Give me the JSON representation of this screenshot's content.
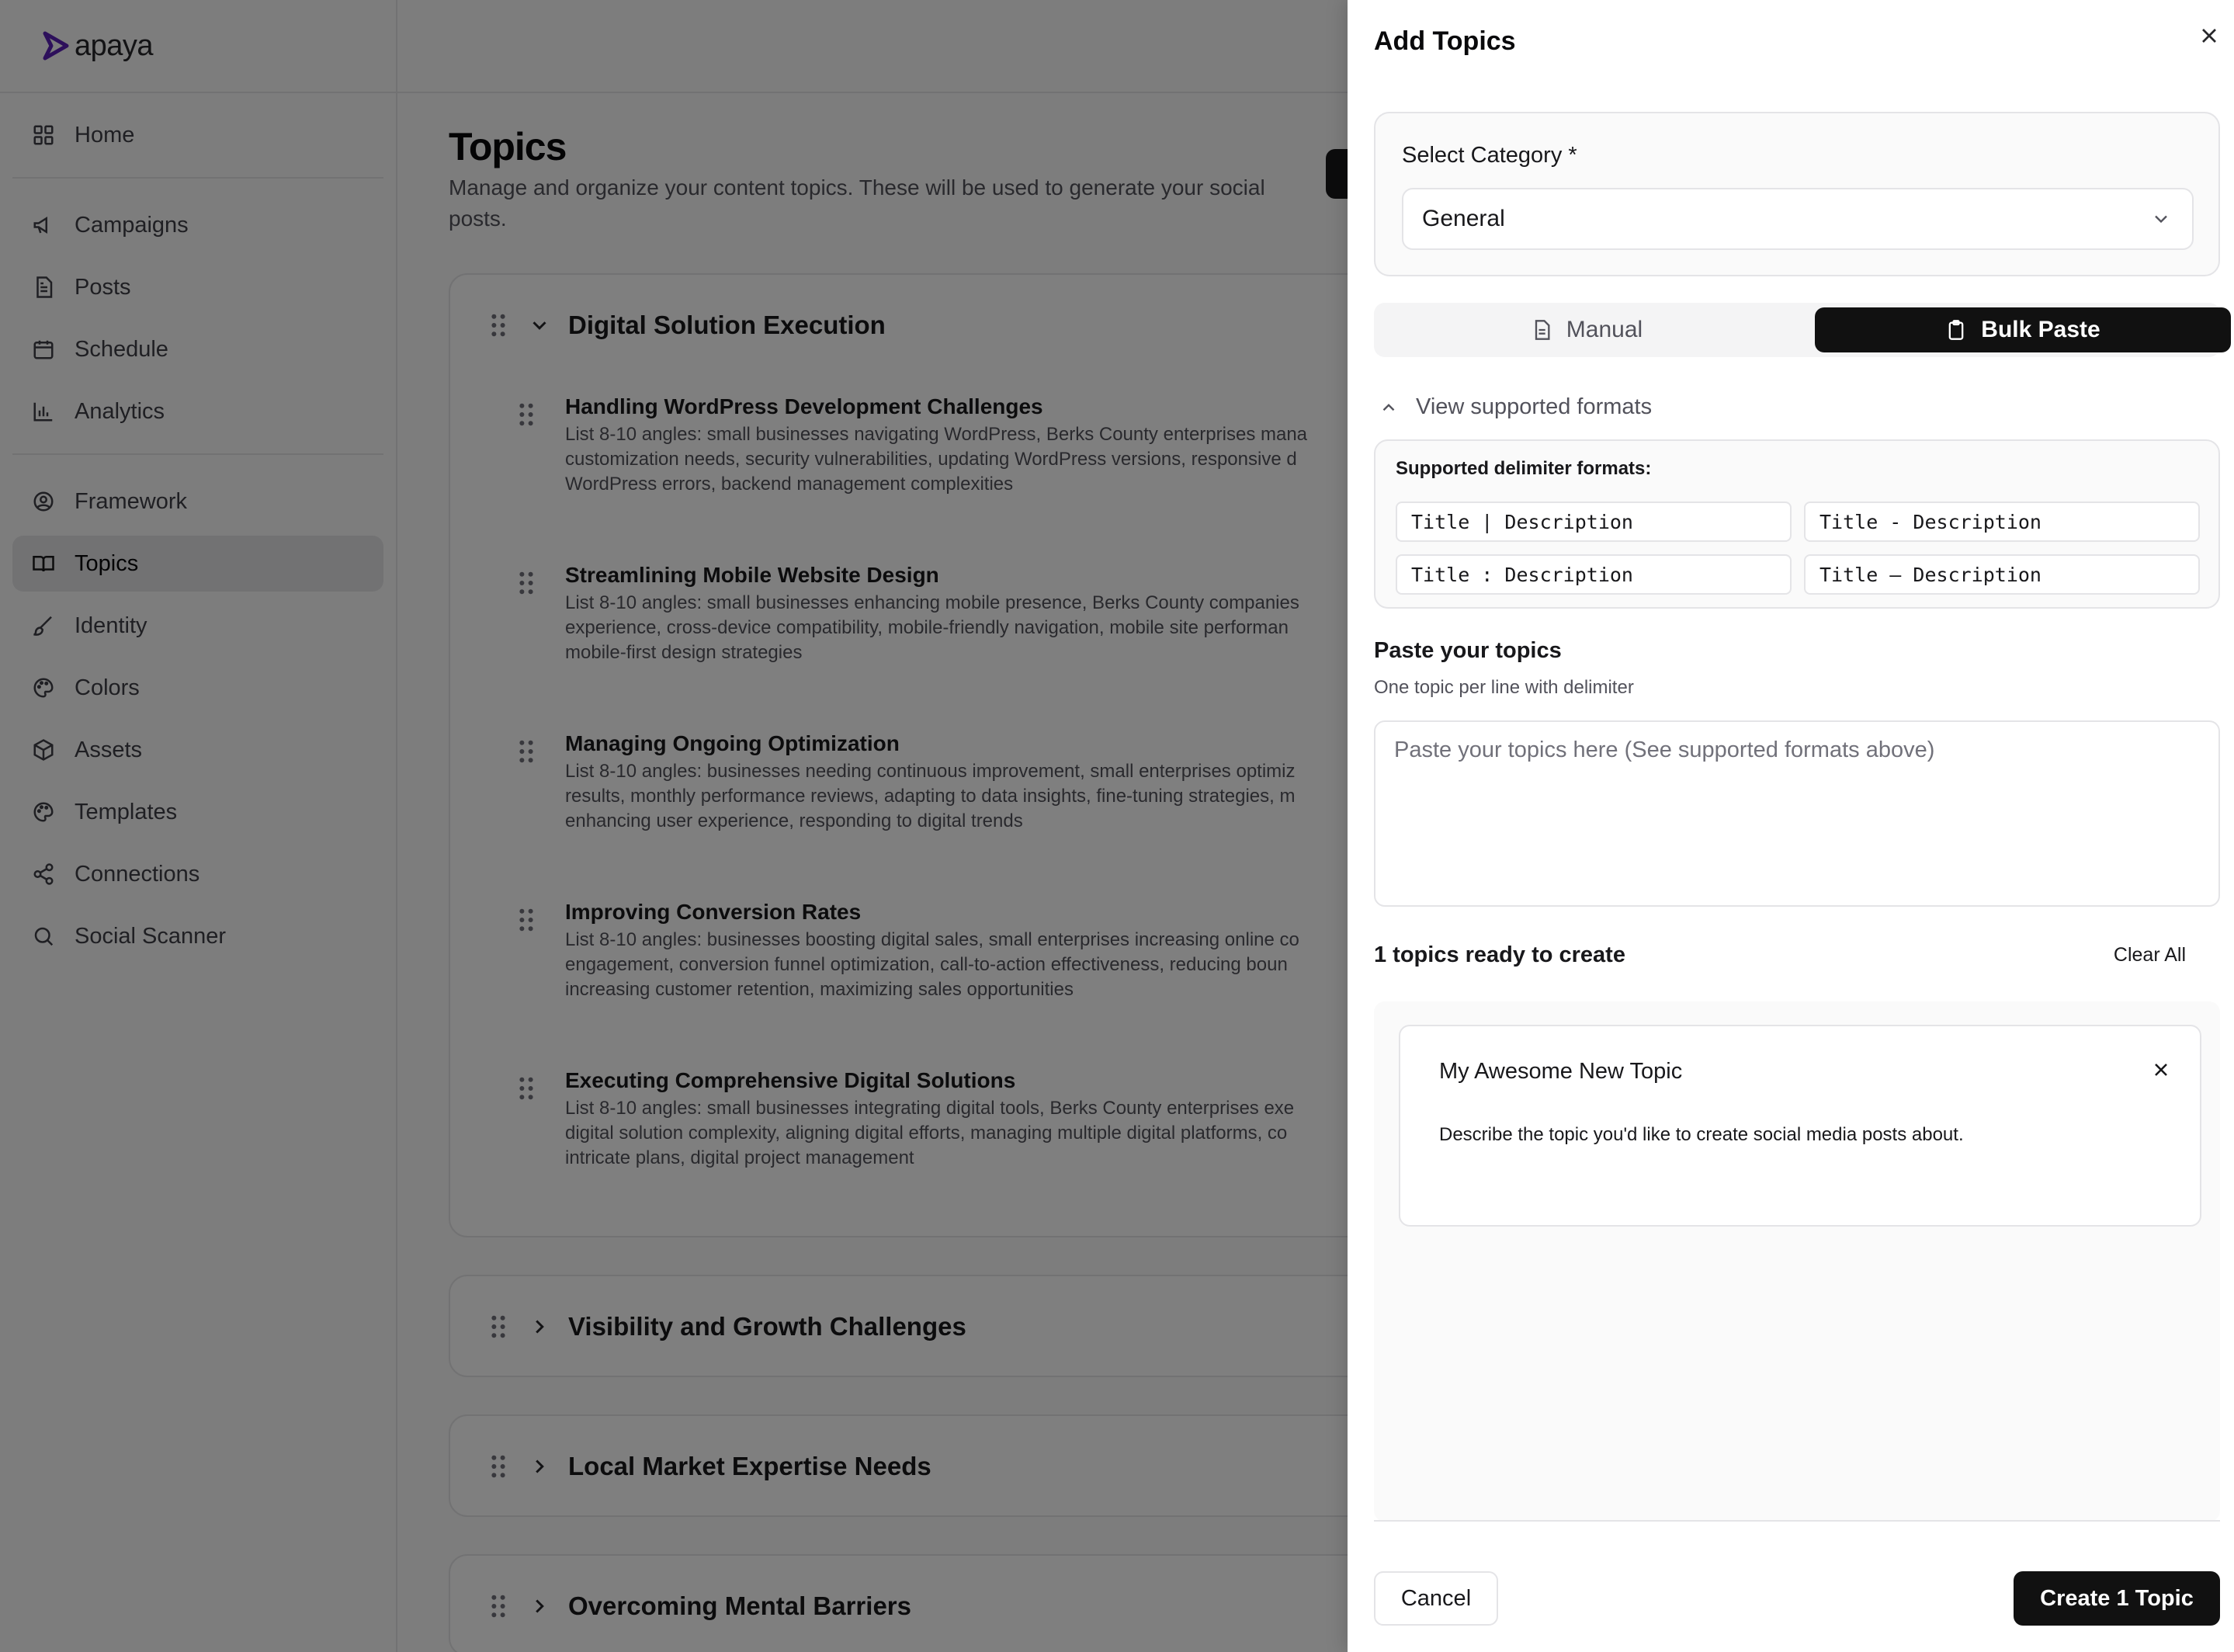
{
  "brand": {
    "name": "apaya",
    "accent": "#5b21b6"
  },
  "sidebar": {
    "items": [
      {
        "label": "Home",
        "icon": "home-grid-icon"
      },
      {
        "label": "Campaigns",
        "icon": "megaphone-icon"
      },
      {
        "label": "Posts",
        "icon": "document-icon"
      },
      {
        "label": "Schedule",
        "icon": "calendar-icon"
      },
      {
        "label": "Analytics",
        "icon": "bar-chart-icon"
      },
      {
        "label": "Framework",
        "icon": "user-circle-icon"
      },
      {
        "label": "Topics",
        "icon": "book-open-icon",
        "active": true
      },
      {
        "label": "Identity",
        "icon": "brush-icon"
      },
      {
        "label": "Colors",
        "icon": "palette-icon"
      },
      {
        "label": "Assets",
        "icon": "cube-icon"
      },
      {
        "label": "Templates",
        "icon": "palette-icon"
      },
      {
        "label": "Connections",
        "icon": "share-icon"
      },
      {
        "label": "Social Scanner",
        "icon": "search-icon"
      }
    ]
  },
  "page": {
    "title": "Topics",
    "subtitle": "Manage and organize your content topics. These will be used to generate your social posts."
  },
  "groups": [
    {
      "title": "Digital Solution Execution",
      "expanded": true,
      "topics": [
        {
          "title": "Handling WordPress Development Challenges",
          "desc_lines": [
            "List 8-10 angles: small businesses navigating WordPress, Berks County enterprises mana",
            "customization needs, security vulnerabilities, updating WordPress versions, responsive d",
            "WordPress errors, backend management complexities"
          ]
        },
        {
          "title": "Streamlining Mobile Website Design",
          "desc_lines": [
            "List 8-10 angles: small businesses enhancing mobile presence, Berks County companies",
            "experience, cross-device compatibility, mobile-friendly navigation, mobile site performan",
            "mobile-first design strategies"
          ]
        },
        {
          "title": "Managing Ongoing Optimization",
          "desc_lines": [
            "List 8-10 angles: businesses needing continuous improvement, small enterprises optimiz",
            "results, monthly performance reviews, adapting to data insights, fine-tuning strategies, m",
            "enhancing user experience, responding to digital trends"
          ]
        },
        {
          "title": "Improving Conversion Rates",
          "desc_lines": [
            "List 8-10 angles: businesses boosting digital sales, small enterprises increasing online co",
            "engagement, conversion funnel optimization, call-to-action effectiveness, reducing boun",
            "increasing customer retention, maximizing sales opportunities"
          ]
        },
        {
          "title": "Executing Comprehensive Digital Solutions",
          "desc_lines": [
            "List 8-10 angles: small businesses integrating digital tools, Berks County enterprises exe",
            "digital solution complexity, aligning digital efforts, managing multiple digital platforms, co",
            "intricate plans, digital project management"
          ]
        }
      ]
    },
    {
      "title": "Visibility and Growth Challenges",
      "expanded": false
    },
    {
      "title": "Local Market Expertise Needs",
      "expanded": false
    },
    {
      "title": "Overcoming Mental Barriers",
      "expanded": false
    }
  ],
  "drawer": {
    "title": "Add Topics",
    "category_label": "Select Category *",
    "category_value": "General",
    "tabs": {
      "manual": "Manual",
      "bulk": "Bulk Paste",
      "active": "bulk"
    },
    "formats_toggle": "View supported formats",
    "formats_title": "Supported delimiter formats:",
    "formats": [
      "Title | Description",
      "Title - Description",
      "Title : Description",
      "Title — Description"
    ],
    "paste_label": "Paste your topics",
    "paste_hint": "One topic per line with delimiter",
    "paste_placeholder": "Paste your topics here (See supported formats above)",
    "ready_text": "1 topics ready to create",
    "clear_all": "Clear All",
    "preview_topic": {
      "title": "My Awesome New Topic",
      "desc": "Describe the topic you'd like to create social media posts about."
    },
    "cancel": "Cancel",
    "create": "Create 1 Topic"
  }
}
